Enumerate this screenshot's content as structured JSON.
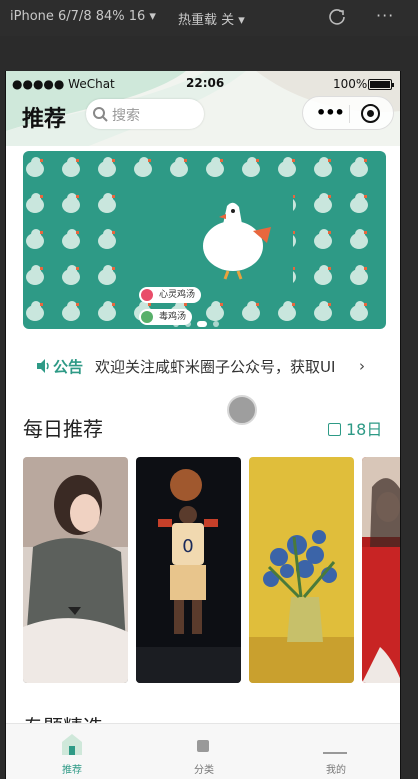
{
  "devtools": {
    "device": "iPhone 6/7/8 84% 16 ▾",
    "hot_reload": "热重载 关 ▾",
    "more": "···"
  },
  "statusbar": {
    "carrier": "●●●●● WeChat",
    "time": "22:06",
    "battery": "100%",
    "battery_level": 1.0
  },
  "header": {
    "title": "推荐",
    "search_placeholder": "搜索",
    "menu_dots": "•••"
  },
  "banner": {
    "pills": [
      "心灵鸡汤",
      "毒鸡汤"
    ],
    "page_count": 4,
    "active_page": 2,
    "colors": {
      "bg": "#2e9a86",
      "accent": "#e8673e"
    }
  },
  "notice": {
    "tag": "公告",
    "text": "欢迎关注咸虾米圈子公众号，获取UI",
    "chevron": "›"
  },
  "daily": {
    "title": "每日推荐",
    "date": "18日"
  },
  "next_section": {
    "title": "专题精选"
  },
  "cards": [
    {
      "name": "girl-portrait",
      "desc": "photo"
    },
    {
      "name": "basketball-player",
      "desc": "photo"
    },
    {
      "name": "van-gogh-irises",
      "desc": "painting"
    },
    {
      "name": "red-dress-woman",
      "desc": "photo"
    }
  ],
  "tabs": [
    {
      "label": "推荐",
      "active": true
    },
    {
      "label": "分类",
      "active": false
    },
    {
      "label": "我的",
      "active": false
    }
  ],
  "theme": {
    "accent": "#2e9a86"
  }
}
